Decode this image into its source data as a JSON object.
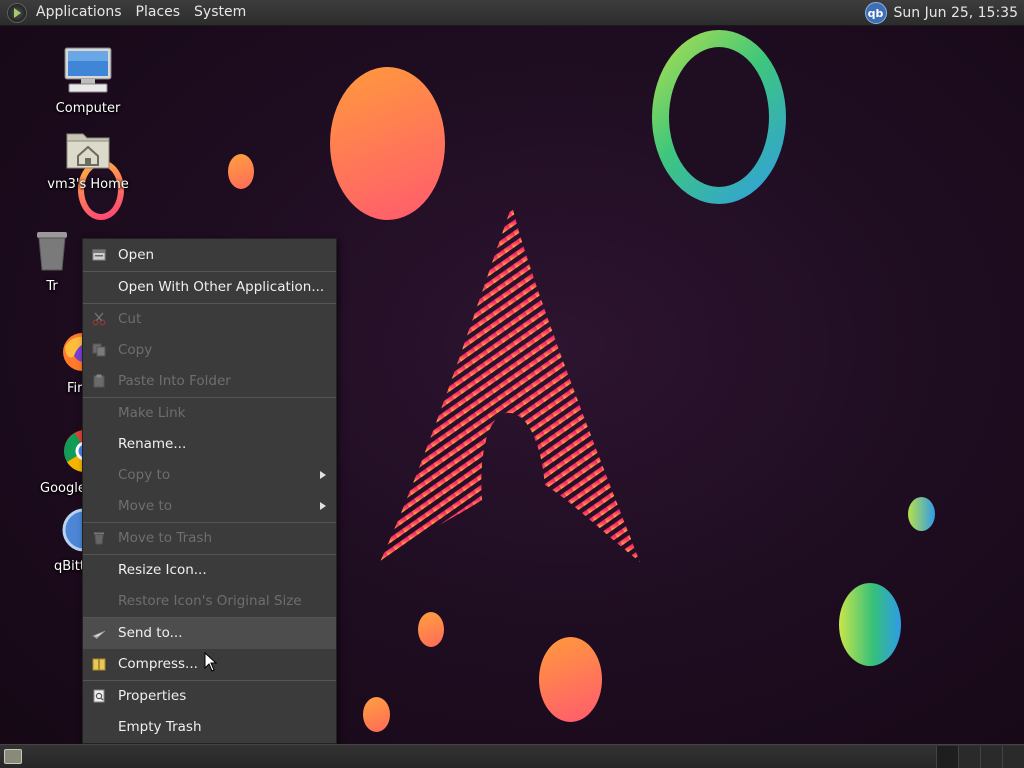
{
  "top_panel": {
    "menus": [
      "Applications",
      "Places",
      "System"
    ],
    "tray_label": "qb",
    "clock": "Sun Jun 25, 15:35"
  },
  "desktop_icons": [
    {
      "label": "Computer",
      "icon": "computer-icon"
    },
    {
      "label": "vm3's Home",
      "icon": "home-folder-icon"
    },
    {
      "label": "Tr",
      "icon": "trash-icon"
    },
    {
      "label": "Fir",
      "icon": "firefox-icon"
    },
    {
      "label": "Google",
      "icon": "chrome-icon"
    },
    {
      "label": "qBitt",
      "icon": "qbittorrent-icon"
    }
  ],
  "context_menu": {
    "items": [
      {
        "label": "Open",
        "enabled": true,
        "icon": "open-icon"
      },
      {
        "label": "Open With Other Application...",
        "enabled": true
      },
      {
        "label": "Cut",
        "enabled": false,
        "icon": "scissors-icon"
      },
      {
        "label": "Copy",
        "enabled": false,
        "icon": "copy-icon"
      },
      {
        "label": "Paste Into Folder",
        "enabled": false,
        "icon": "paste-icon"
      },
      {
        "label": "Make Link",
        "enabled": false
      },
      {
        "label": "Rename...",
        "enabled": true
      },
      {
        "label": "Copy to",
        "enabled": false,
        "submenu": true
      },
      {
        "label": "Move to",
        "enabled": false,
        "submenu": true
      },
      {
        "label": "Move to Trash",
        "enabled": false,
        "icon": "trash-icon"
      },
      {
        "label": "Resize Icon...",
        "enabled": true
      },
      {
        "label": "Restore Icon's Original Size",
        "enabled": false
      },
      {
        "label": "Send to...",
        "enabled": true,
        "icon": "send-icon",
        "highlighted": true
      },
      {
        "label": "Compress...",
        "enabled": true,
        "icon": "archive-icon"
      },
      {
        "label": "Properties",
        "enabled": true,
        "icon": "properties-icon"
      },
      {
        "label": "Empty Trash",
        "enabled": true
      }
    ]
  },
  "colors": {
    "menu_bg": "#3b3b3b",
    "menu_text": "#f0f0f0",
    "menu_disabled": "#6e6e6e",
    "panel_bg": "#2c2c2c",
    "desktop_bg": "#1f0d22"
  }
}
